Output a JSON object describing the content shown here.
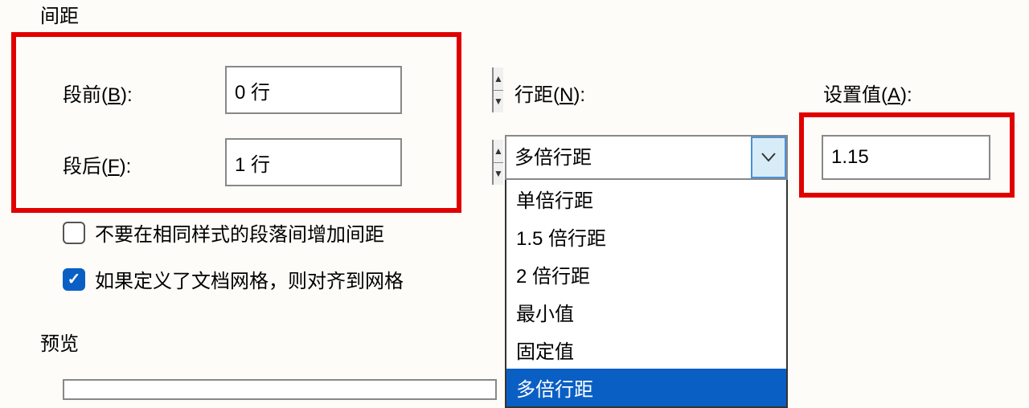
{
  "section": {
    "spacing_title": "间距",
    "preview_title": "预览"
  },
  "labels": {
    "before": "段前(",
    "before_key": "B",
    "after": "段后(",
    "after_key": "F",
    "line_spacing": "行距(",
    "line_spacing_key": "N",
    "set_value": "设置值(",
    "set_value_key": "A",
    "close_paren": "):"
  },
  "fields": {
    "before_value": "0 行",
    "after_value": "1 行",
    "line_spacing_selected": "多倍行距",
    "set_value_number": "1.15"
  },
  "dropdown_options": [
    "单倍行距",
    "1.5 倍行距",
    "2 倍行距",
    "最小值",
    "固定值",
    "多倍行距"
  ],
  "checkboxes": {
    "no_space_same_style": "不要在相同样式的段落间增加间距",
    "snap_to_grid": "如果定义了文档网格，则对齐到网格"
  }
}
